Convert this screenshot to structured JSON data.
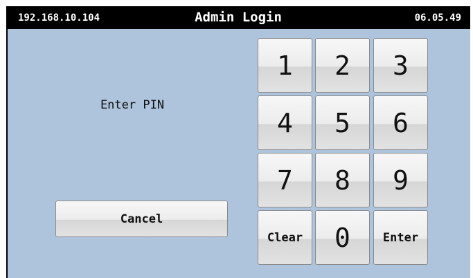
{
  "header": {
    "ip_address": "192.168.10.104",
    "title": "Admin Login",
    "time": "06.05.49"
  },
  "prompt": "Enter PIN",
  "cancel_label": "Cancel",
  "keypad": {
    "k1": "1",
    "k2": "2",
    "k3": "3",
    "k4": "4",
    "k5": "5",
    "k6": "6",
    "k7": "7",
    "k8": "8",
    "k9": "9",
    "clear": "Clear",
    "k0": "0",
    "enter": "Enter"
  },
  "colors": {
    "background": "#aec4dc",
    "header": "#000000",
    "button_face": "#ececec"
  }
}
